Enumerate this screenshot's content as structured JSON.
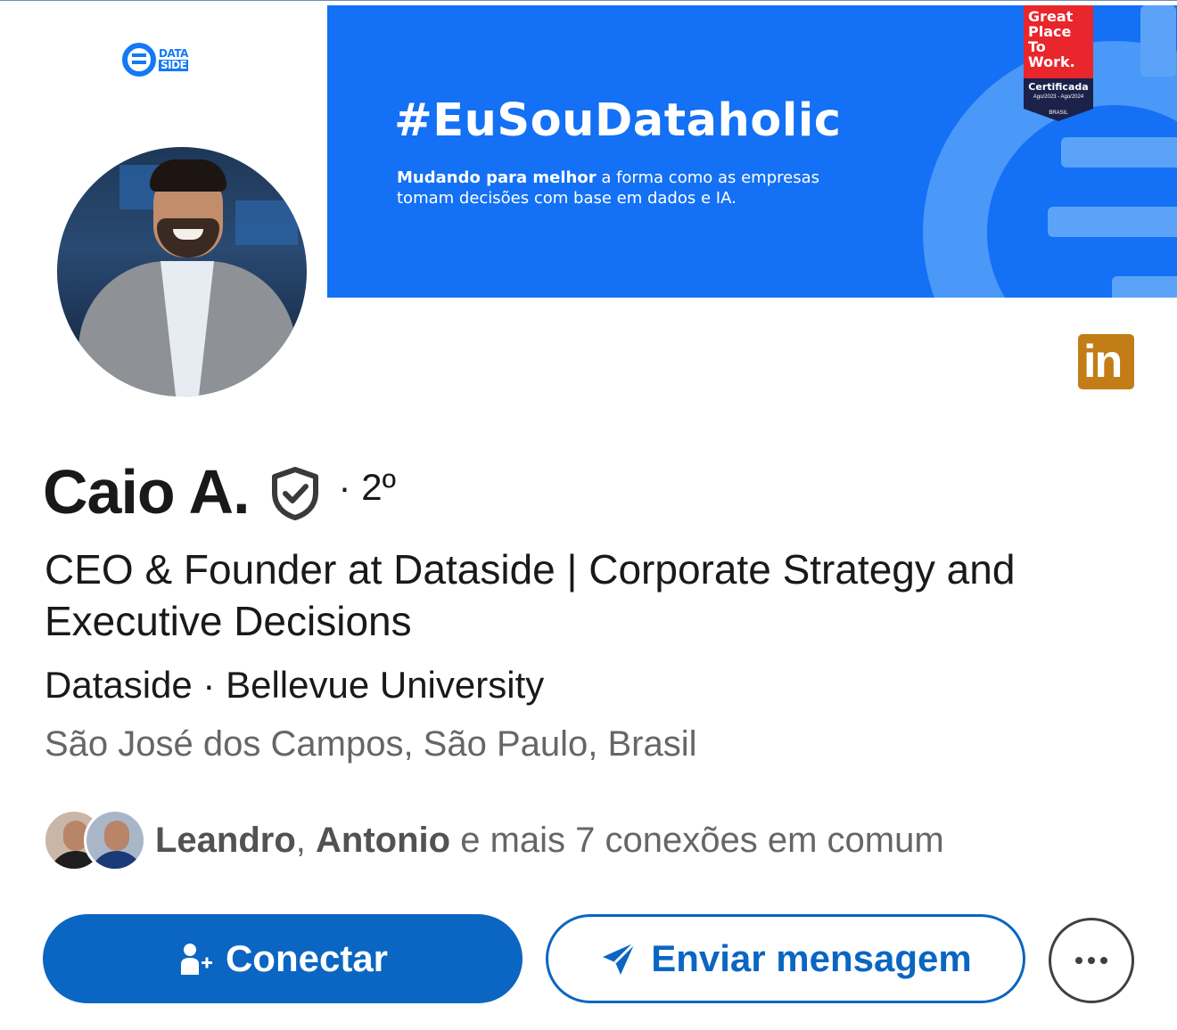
{
  "logo": {
    "name": "DATA SIDE",
    "line1": "DATA",
    "line2": "SIDE"
  },
  "banner": {
    "hashtag": "#EuSouDataholic",
    "subtitle_bold": "Mudando para melhor",
    "subtitle_rest_line1": " a forma como as empresas",
    "subtitle_line2": "tomam decisões com base em dados e IA.",
    "background_color": "#1470f4",
    "badge": {
      "line1": "Great",
      "line2": "Place",
      "line3": "To",
      "line4": "Work.",
      "certified": "Certificada",
      "period": "Ago/2023 - Ago/2024",
      "country": "BRASIL"
    }
  },
  "linkedin_badge": {
    "text": "in",
    "color": "#c37d16"
  },
  "profile": {
    "name": "Caio A.",
    "degree_sep": "·",
    "degree": "2º",
    "headline": "CEO & Founder at Dataside | Corporate Strategy and Executive Decisions",
    "org_line": "Dataside · Bellevue University",
    "location": "São José dos Campos, São Paulo, Brasil"
  },
  "mutual": {
    "name1": "Leandro",
    "sep": ", ",
    "name2": "Antonio",
    "rest": " e mais 7 conexões em comum"
  },
  "actions": {
    "connect_label": "Conectar",
    "message_label": "Enviar mensagem",
    "accent_color": "#0a66c2"
  }
}
